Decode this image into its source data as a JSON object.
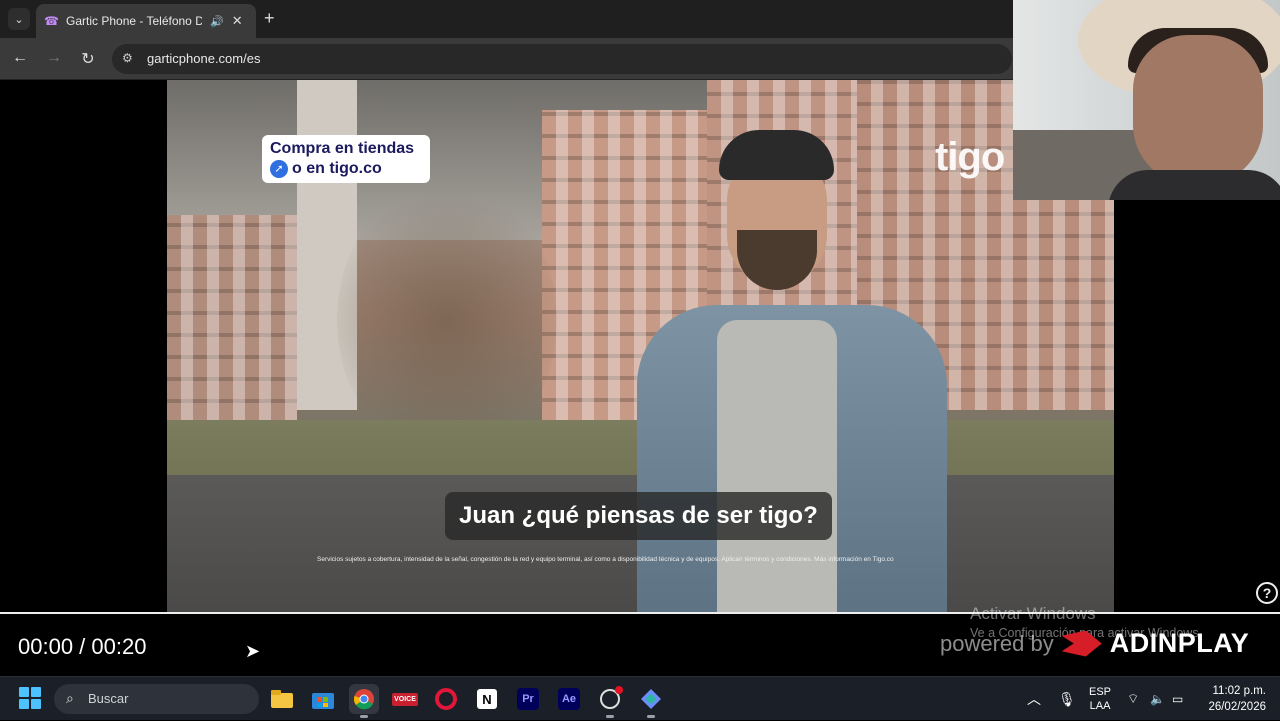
{
  "browser": {
    "tab_title": "Gartic Phone - Teléfono De",
    "url": "garticphone.com/es"
  },
  "video": {
    "promo_line1": "Compra en tiendas",
    "promo_line2": "o en tigo.co",
    "brand_logo": "tigo",
    "subtitle": "Juan ¿qué piensas de ser tigo?",
    "legal_text": "Servicios sujetos a cobertura, intensidad de la señal, congestión de la red y equipo terminal, así como a disponibilidad técnica y de equipos. Aplican términos y condiciones. Más información en Tigo.co",
    "time_display": "00:00 / 00:20",
    "progress": 0,
    "help_icon": "?",
    "ad_network": {
      "powered_by": "powered by",
      "name": "ADINPLAY"
    }
  },
  "windows_watermark": {
    "title": "Activar Windows",
    "subtitle": "Ve a Configuración para activar Windows."
  },
  "taskbar": {
    "search_label": "Buscar",
    "apps": [
      {
        "name": "file-explorer",
        "label": ""
      },
      {
        "name": "microsoft-store",
        "label": ""
      },
      {
        "name": "chrome",
        "label": ""
      },
      {
        "name": "voicemeeter",
        "label": "VOICE"
      },
      {
        "name": "opera",
        "label": "O"
      },
      {
        "name": "notion",
        "label": "N"
      },
      {
        "name": "premiere-pro",
        "label": "Pr"
      },
      {
        "name": "after-effects",
        "label": "Ae"
      },
      {
        "name": "obs",
        "label": ""
      },
      {
        "name": "app-diamond",
        "label": ""
      }
    ],
    "language_line1": "ESP",
    "language_line2": "LAA",
    "time": "11:02 p.m.",
    "date": "26/02/2026"
  },
  "colors": {
    "accent": "#4cc2ff",
    "promo_text": "#1b1a5e",
    "adinplay_red": "#d71e28"
  }
}
